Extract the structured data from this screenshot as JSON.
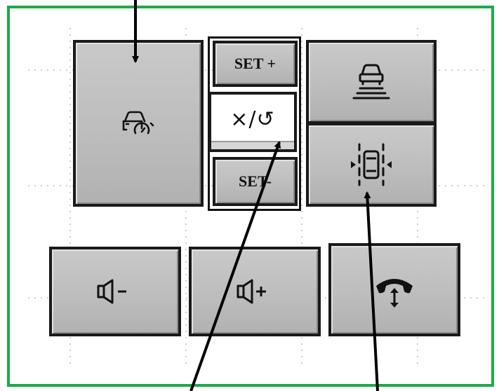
{
  "panel": {
    "frame_color": "#1daa4a",
    "button_color": "#bdbdbd",
    "border_color": "#1a1a1a"
  },
  "buttons": {
    "cruise_control": {
      "icon": "cruise-control-icon"
    },
    "set_plus": {
      "label": "SET +"
    },
    "cancel_resume": {
      "label": "×/↺",
      "icon": "cancel-resume-icon"
    },
    "set_minus": {
      "label": "SET-"
    },
    "distance": {
      "icon": "following-distance-icon"
    },
    "lane_assist": {
      "icon": "lane-keep-assist-icon"
    },
    "volume_down": {
      "icon": "volume-down-icon"
    },
    "volume_up": {
      "icon": "volume-up-icon"
    },
    "phone": {
      "icon": "phone-call-icon"
    }
  },
  "annotations": {
    "arrows": [
      "pointer-to-cruise-control",
      "pointer-to-cancel-resume",
      "pointer-to-lane-assist"
    ]
  }
}
